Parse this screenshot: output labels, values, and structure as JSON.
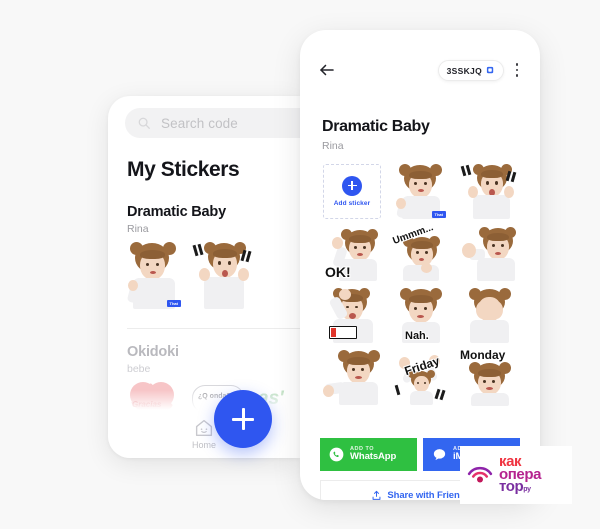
{
  "background_color": "#f8f8f8",
  "accent_blue": "#2f56f0",
  "whatsapp_green": "#2fc041",
  "imessage_blue": "#3366f0",
  "left_phone": {
    "search": {
      "placeholder": "Search code",
      "icon": "search-icon"
    },
    "page_title": "My Stickers",
    "packs": [
      {
        "title": "Dramatic Baby",
        "author": "Rina"
      },
      {
        "title": "Okidoki",
        "author": "bebe"
      }
    ],
    "pack1_stickers": [
      {
        "name": "thumbs-up-girl",
        "caption": ""
      },
      {
        "name": "shocked-girl",
        "caption": "!!"
      }
    ],
    "pack2_stickers": [
      {
        "name": "gracias-heart",
        "caption": "Gracias"
      },
      {
        "name": "que-onda-bubble",
        "caption": "¿Q onda?"
      },
      {
        "name": "green-script",
        "caption": "as"
      }
    ],
    "tabbar": {
      "home_label": "Home",
      "home_icon": "home-icon"
    },
    "fab": {
      "icon": "plus-icon",
      "label": ""
    }
  },
  "right_phone": {
    "back_icon": "back-arrow-icon",
    "code_badge": {
      "text": "3SSKJQ",
      "icon": "copy-icon"
    },
    "menu_icon": "kebab-menu-icon",
    "pack_title": "Dramatic Baby",
    "pack_author": "Rina",
    "add_sticker": {
      "label": "Add sticker",
      "icon": "plus-icon"
    },
    "stickers": [
      {
        "name": "thumbs-up-girl",
        "caption": "That"
      },
      {
        "name": "shocked-girl-exclaim",
        "caption": "!!"
      },
      {
        "name": "ok-girl",
        "caption": "OK!"
      },
      {
        "name": "ummm-girl",
        "caption": "Ummm..."
      },
      {
        "name": "stop-hand-girl",
        "caption": ""
      },
      {
        "name": "low-battery-girl",
        "caption": ""
      },
      {
        "name": "nah-girl",
        "caption": "Nah."
      },
      {
        "name": "facepalm-girl",
        "caption": ""
      },
      {
        "name": "thumbs-down-girl",
        "caption": ""
      },
      {
        "name": "friday-girl",
        "caption": "Friday"
      },
      {
        "name": "monday-girl",
        "caption": "Monday"
      }
    ],
    "buttons": {
      "whatsapp": {
        "kicker": "ADD TO",
        "name": "WhatsApp",
        "icon": "whatsapp-icon"
      },
      "imessage": {
        "kicker": "ADD TO",
        "name": "iMessage",
        "icon": "imessage-icon"
      },
      "share": {
        "label": "Share with Friends",
        "icon": "share-icon"
      }
    }
  },
  "watermark": {
    "line1": "как",
    "line2": "опера",
    "line3": "тор",
    "suffix": "ру",
    "icon": "signal-waves-icon"
  }
}
